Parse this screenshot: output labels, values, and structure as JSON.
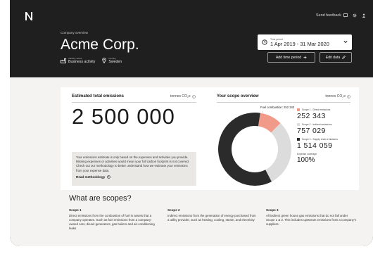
{
  "header": {
    "logo_icon": "n-logo-icon",
    "send_feedback_label": "Send feedback",
    "feedback_icon": "feedback-icon",
    "settings_icon": "gear-icon",
    "user_icon": "user-icon"
  },
  "company": {
    "overview_label": "Company overview",
    "name": "Acme Corp.",
    "sector_key": "Industry sector",
    "sector_value": "Business activity",
    "country_key": "Country",
    "country_value": "Sweden"
  },
  "period": {
    "key": "Time period",
    "value": "1 Apr 2019 - 31 Mar 2020",
    "add_label": "Add time period",
    "edit_label": "Edit data"
  },
  "emissions": {
    "title": "Estimated total emissions",
    "unit": "tonnes CO₂e",
    "total": "2 500 000",
    "notice": "Your emissions estimate is only based on the expenses and activities you provide. Missing expenses or activities would mean your full carbon footprint is not covered. Check out our methodology to better understand how we estimate your emissions from your expense data.",
    "read_more": "Read methodology"
  },
  "scope_overview": {
    "title": "Your scope overview",
    "unit": "tonnes CO₂e",
    "callout": "Fuel combustion: 252 343",
    "coverage_label": "Expense coverage",
    "coverage_value": "100%"
  },
  "chart_data": {
    "type": "pie",
    "series": [
      {
        "name": "Scope 1 - Direct emissions",
        "value": 252343,
        "display": "252 343",
        "color": "#f19a8a"
      },
      {
        "name": "Scope 2 - Indirect emissions",
        "value": 757029,
        "display": "757 029",
        "color": "#dcdcdc"
      },
      {
        "name": "Scope 3 - Supply chain emissions",
        "value": 1514059,
        "display": "1 514 059",
        "color": "#2b2b2b"
      }
    ]
  },
  "scopes": {
    "heading": "What are scopes?",
    "items": [
      {
        "title": "Scope 1",
        "text": "Direct emissions from the combustion of fuel in assets that a company operates. Such as fuel emissions from a company-owned cars, diesel generators, gas boilers and air-conditioning leaks."
      },
      {
        "title": "Scope 2",
        "text": "Indirect emissions from the generation of energy purchased from a utility provider, such as heating, cooling, steam, and electricity"
      },
      {
        "title": "Scope 3",
        "text": "All indirect green house gas emissions that do not fall under Scope 1 & 2. This includes upstream emissions from a company's suppliers."
      }
    ]
  }
}
